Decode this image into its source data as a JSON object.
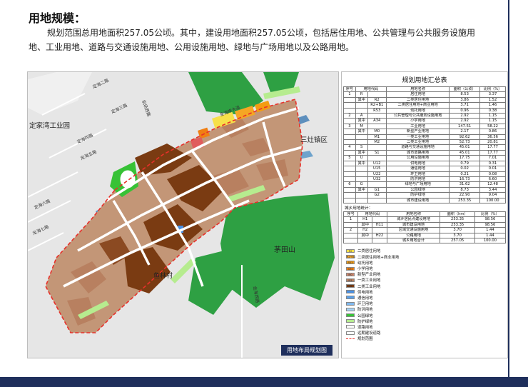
{
  "header": {
    "title": "用地规模：",
    "paragraph": "规划范围总用地面积257.05公顷。其中，建设用地面积257.05公顷，包括居住用地、公共管理与公共服务设施用地、工业用地、道路与交通设施用地、公用设施用地、绿地与广场用地以及公路用地。"
  },
  "map": {
    "caption": "用地布局规划图",
    "place_labels": {
      "dingjiawan": "定家湾工业园",
      "sanzao": "三灶镇区",
      "maotianshan": "茅田山",
      "yulincun": "鱼林村"
    },
    "road_labels": {
      "dinghaier": "定海二路",
      "dinghaisan": "定海三路",
      "dinghaisi": "定海四路",
      "dinghaiwu": "定海五路",
      "dinghailiu": "定海六路",
      "dinghaiqi": "定海七路",
      "jichang": "机场西路",
      "jinhai": "金海岸大道",
      "jinhaixi": "金海西路"
    }
  },
  "table": {
    "title": "规划用地汇总表",
    "headers": [
      "序号",
      "用地代码",
      "",
      "用地名称",
      "面积（公顷）",
      "比例（%）"
    ],
    "rows": [
      {
        "no": "1",
        "code1": "R",
        "code2": "",
        "name": "居住用地",
        "area": "8.53",
        "pct": "3.37"
      },
      {
        "no": "",
        "code1": "其中",
        "code2": "R2",
        "name": "二类居住用地",
        "area": "3.86",
        "pct": "1.52"
      },
      {
        "no": "",
        "code1": "",
        "code2": "R2+B1",
        "name": "二类居住用地+商业用地",
        "area": "3.71",
        "pct": "1.46"
      },
      {
        "no": "",
        "code1": "",
        "code2": "R53",
        "name": "幼托用地",
        "area": "0.96",
        "pct": "0.38"
      },
      {
        "no": "2",
        "code1": "A",
        "code2": "",
        "name": "公共管理与公共服务设施用地",
        "area": "2.92",
        "pct": "1.15"
      },
      {
        "no": "",
        "code1": "其中",
        "code2": "A34",
        "name": "小学用地",
        "area": "2.92",
        "pct": "1.15"
      },
      {
        "no": "3",
        "code1": "M",
        "code2": "",
        "name": "工业用地",
        "area": "147.51",
        "pct": "58.22"
      },
      {
        "no": "",
        "code1": "其中",
        "code2": "M0",
        "name": "新型产业用地",
        "area": "2.17",
        "pct": "0.86"
      },
      {
        "no": "",
        "code1": "",
        "code2": "M1",
        "name": "一类工业用地",
        "area": "92.62",
        "pct": "36.56"
      },
      {
        "no": "",
        "code1": "",
        "code2": "M2",
        "name": "二类工业用地",
        "area": "52.73",
        "pct": "20.81"
      },
      {
        "no": "4",
        "code1": "S",
        "code2": "",
        "name": "道路与交通设施用地",
        "area": "45.01",
        "pct": "17.77"
      },
      {
        "no": "",
        "code1": "其中",
        "code2": "S1",
        "name": "城市道路用地",
        "area": "45.01",
        "pct": "17.77"
      },
      {
        "no": "5",
        "code1": "U",
        "code2": "",
        "name": "公用设施用地",
        "area": "17.75",
        "pct": "7.01"
      },
      {
        "no": "",
        "code1": "其中",
        "code2": "U12",
        "name": "供电用地",
        "area": "0.79",
        "pct": "0.31"
      },
      {
        "no": "",
        "code1": "",
        "code2": "U15",
        "name": "通信用地",
        "area": "0.02",
        "pct": "0.01"
      },
      {
        "no": "",
        "code1": "",
        "code2": "U22",
        "name": "环卫用地",
        "area": "0.21",
        "pct": "0.08"
      },
      {
        "no": "",
        "code1": "",
        "code2": "U32",
        "name": "防洪用地",
        "area": "16.73",
        "pct": "6.60"
      },
      {
        "no": "6",
        "code1": "G",
        "code2": "",
        "name": "绿地与广场用地",
        "area": "31.62",
        "pct": "12.48"
      },
      {
        "no": "",
        "code1": "其中",
        "code2": "G1",
        "name": "公园绿地",
        "area": "8.73",
        "pct": "3.44"
      },
      {
        "no": "",
        "code1": "",
        "code2": "G2",
        "name": "防护绿地",
        "area": "22.90",
        "pct": "9.04"
      },
      {
        "no": "",
        "code1": "",
        "code2": "",
        "name": "城市建设用地",
        "area": "253.35",
        "pct": "100.00"
      }
    ],
    "urban_rural_title": "城乡用地统计：",
    "ur_headers": [
      "序号",
      "用地代码",
      "",
      "用地名称",
      "面积（hm）",
      "比例（%）"
    ],
    "ur_rows": [
      {
        "no": "1",
        "code1": "H1",
        "code2": "",
        "name": "城乡居民点建设用地",
        "area": "253.35",
        "pct": "98.56"
      },
      {
        "no": "",
        "code1": "其中",
        "code2": "H11",
        "name": "城市建设用地",
        "area": "253.35",
        "pct": "98.56"
      },
      {
        "no": "2",
        "code1": "H2",
        "code2": "",
        "name": "区域交通设施用地",
        "area": "3.70",
        "pct": "1.44"
      },
      {
        "no": "",
        "code1": "其中",
        "code2": "H22",
        "name": "公路用地",
        "area": "3.70",
        "pct": "1.44"
      },
      {
        "no": "",
        "code1": "",
        "code2": "",
        "name": "城乡用地合计",
        "area": "257.05",
        "pct": "100.00"
      }
    ]
  },
  "legend": [
    {
      "code": "R2",
      "label": "二类居住用地",
      "color": "#f7e04a"
    },
    {
      "code": "R2+B1",
      "label": "二类居住用地+商业用地",
      "color": "#f5a623"
    },
    {
      "code": "R53",
      "label": "幼托用地",
      "color": "#f39c12"
    },
    {
      "code": "A34",
      "label": "小学用地",
      "color": "#f07f13"
    },
    {
      "code": "M0",
      "label": "新型产业用地",
      "color": "#d2886d"
    },
    {
      "code": "M1",
      "label": "一类工业用地",
      "color": "#b88060"
    },
    {
      "code": "M2",
      "label": "二类工业用地",
      "color": "#7a3b12"
    },
    {
      "code": "",
      "label": "供电用地",
      "color": "#4a90e2"
    },
    {
      "code": "",
      "label": "通信用地",
      "color": "#5aa0e8"
    },
    {
      "code": "",
      "label": "环卫用地",
      "color": "#7fb8ee"
    },
    {
      "code": "",
      "label": "防洪用地",
      "color": "#a8d4f5"
    },
    {
      "code": "",
      "label": "公园绿地",
      "color": "#37c236"
    },
    {
      "code": "",
      "label": "防护绿地",
      "color": "#b6ec8f"
    },
    {
      "code": "",
      "label": "道路用地",
      "color": "#ffffff"
    },
    {
      "code": "",
      "label": "远期建设道路",
      "color": "#ffffff"
    },
    {
      "code": "",
      "label": "规划范围",
      "color": "#e8302a"
    }
  ]
}
